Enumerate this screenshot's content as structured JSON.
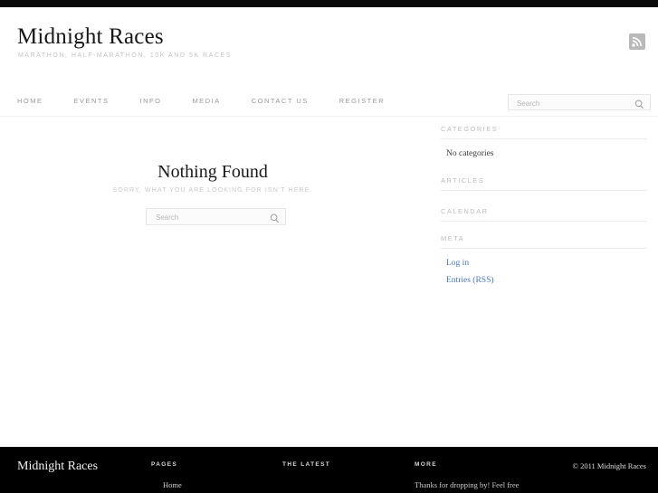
{
  "site": {
    "title": "Midnight Races",
    "tagline": "MARATHON, HALF-MARATHON, 10K AND 5K RACES",
    "rss_icon": "rss-feed-icon"
  },
  "nav": {
    "items": [
      {
        "label": "HOME"
      },
      {
        "label": "EVENTS"
      },
      {
        "label": "INFO"
      },
      {
        "label": "MEDIA"
      },
      {
        "label": "CONTACT US"
      },
      {
        "label": "REGISTER"
      }
    ]
  },
  "header_search": {
    "value": "",
    "placeholder": "Search",
    "icon": "search-icon"
  },
  "main": {
    "heading": "Nothing Found",
    "subheading": "SORRY, WHAT YOU ARE LOOKING FOR ISN'T HERE.",
    "search": {
      "value": "",
      "placeholder": "Search",
      "icon": "search-icon"
    }
  },
  "sidebar": {
    "widgets": [
      {
        "title": "CATEGORIES",
        "items": [
          {
            "label": "No categories",
            "is_link": false
          }
        ]
      },
      {
        "title": "ARTICLES",
        "items": []
      },
      {
        "title": "CALENDAR",
        "items": []
      },
      {
        "title": "META",
        "items": [
          {
            "label": "Log in",
            "is_link": true
          },
          {
            "label": "Entries (RSS)",
            "is_link": true
          }
        ]
      }
    ]
  },
  "footer": {
    "brand": "Midnight Races",
    "columns": [
      {
        "title": "PAGES",
        "items": [
          {
            "label": "Home"
          }
        ]
      },
      {
        "title": "THE LATEST",
        "items": []
      },
      {
        "title": "MORE",
        "text": "Thanks for dropping by! Feel free"
      }
    ],
    "copyright": "© 2011 Midnight Races"
  },
  "colors": {
    "accent_link": "#4a78b5",
    "footer_bg": "#000000",
    "muted_text": "#c3c3c3"
  }
}
